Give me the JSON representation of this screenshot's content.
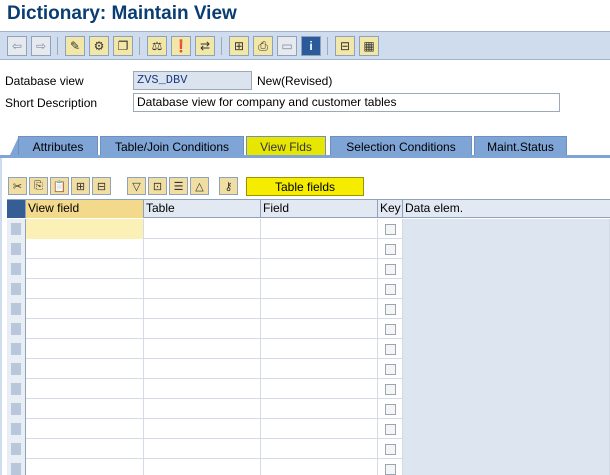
{
  "window": {
    "title": "Dictionary: Maintain View"
  },
  "toolbar": {
    "buttons": [
      {
        "icon": "back-arrow-icon",
        "glyph": "⇦"
      },
      {
        "icon": "forward-arrow-icon",
        "glyph": "⇨"
      },
      {
        "icon": "display-change-icon",
        "glyph": "✎"
      },
      {
        "icon": "active-inactive-icon",
        "glyph": "⚙"
      },
      {
        "icon": "other-object-icon",
        "glyph": "❐"
      },
      {
        "icon": "check-icon",
        "glyph": "⚖"
      },
      {
        "icon": "activate-icon",
        "glyph": "❗"
      },
      {
        "icon": "where-used-icon",
        "glyph": "⇄"
      },
      {
        "icon": "hierarchy-icon",
        "glyph": "⊞"
      },
      {
        "icon": "print-icon",
        "glyph": "⎙"
      },
      {
        "icon": "disabled-icon",
        "glyph": "▭"
      },
      {
        "icon": "info-icon",
        "glyph": "i"
      },
      {
        "icon": "tree-icon",
        "glyph": "⊟"
      },
      {
        "icon": "table-icon",
        "glyph": "▦"
      }
    ]
  },
  "form": {
    "database_view_label": "Database view",
    "database_view_value": "ZVS_DBV",
    "status": "New(Revised)",
    "short_description_label": "Short Description",
    "short_description_value": "Database view for company and customer tables"
  },
  "tabs": [
    {
      "label": "Attributes",
      "active": false
    },
    {
      "label": "Table/Join Conditions",
      "active": false
    },
    {
      "label": "View Flds",
      "active": true
    },
    {
      "label": "Selection Conditions",
      "active": false
    },
    {
      "label": "Maint.Status",
      "active": false
    }
  ],
  "grid_toolbar": {
    "buttons": [
      {
        "icon": "cut-icon",
        "glyph": "✂"
      },
      {
        "icon": "copy-icon",
        "glyph": "⎘"
      },
      {
        "icon": "paste-icon",
        "glyph": "📋"
      },
      {
        "icon": "insert-row-icon",
        "glyph": "⊞"
      },
      {
        "icon": "delete-row-icon",
        "glyph": "⊟"
      },
      {
        "icon": "select-all-icon",
        "glyph": "▽"
      },
      {
        "icon": "expand-icon",
        "glyph": "⊡"
      },
      {
        "icon": "filter-icon",
        "glyph": "☰"
      },
      {
        "icon": "collapse-icon",
        "glyph": "△"
      },
      {
        "icon": "key-icon",
        "glyph": "⚷"
      }
    ],
    "table_fields_label": "Table fields"
  },
  "grid": {
    "columns": [
      "View field",
      "Table",
      "Field",
      "Key",
      "Data elem."
    ],
    "row_count": 13
  },
  "colors": {
    "title": "#0a3e73",
    "toolbar_bg": "#cfdced",
    "tab_bg": "#7fa4d6",
    "tab_active_bg": "#e6e600",
    "table_fields_button_bg": "#f5ec00"
  }
}
